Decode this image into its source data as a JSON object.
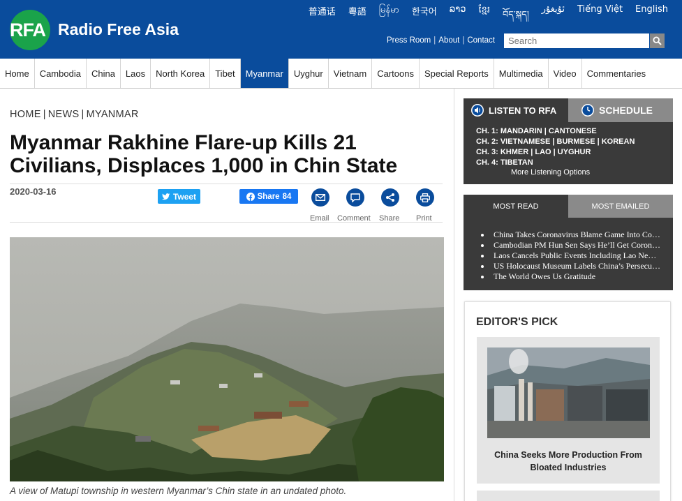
{
  "header": {
    "logo_text": "RFA",
    "site_name": "Radio Free Asia",
    "languages": [
      "普通话",
      "粵語",
      "မြန်မာ",
      "한국어",
      "ລາວ",
      "ខ្មែរ",
      "བོད་སྐད།",
      "ئۇيغۇر",
      "Tiếng Việt",
      "English"
    ],
    "links": [
      "Press Room",
      "About",
      "Contact"
    ],
    "search_placeholder": "Search"
  },
  "nav": {
    "items": [
      "Home",
      "Cambodia",
      "China",
      "Laos",
      "North Korea",
      "Tibet",
      "Myanmar",
      "Uyghur",
      "Vietnam",
      "Cartoons",
      "Special Reports",
      "Multimedia",
      "Video",
      "Commentaries"
    ],
    "active": "Myanmar"
  },
  "article": {
    "breadcrumb": [
      "HOME",
      "NEWS",
      "MYANMAR"
    ],
    "title_line1": "Myanmar Rakhine Flare-up Kills 21",
    "title_line2": "Civilians, Displaces 1,000 in Chin State",
    "date": "2020-03-16",
    "tweet_label": "Tweet",
    "share_label": "Share",
    "share_count": "84",
    "actions": [
      "Email",
      "Comment",
      "Share",
      "Print"
    ],
    "caption": "A view of Matupi township in western Myanmar’s Chin state in an undated photo."
  },
  "listen": {
    "tab_listen": "LISTEN TO RFA",
    "tab_schedule": "SCHEDULE",
    "channels": [
      "CH. 1: MANDARIN | CANTONESE",
      "CH. 2: VIETNAMESE | BURMESE | KOREAN",
      "CH. 3: KHMER | LAO | UYGHUR",
      "CH. 4: TIBETAN"
    ],
    "more": "More Listening Options"
  },
  "most": {
    "tab_read": "MOST READ",
    "tab_emailed": "MOST EMAILED",
    "items": [
      "China Takes Coronavirus Blame Game Into Co…",
      "Cambodian PM Hun Sen Says He’ll Get Coron…",
      "Laos Cancels Public Events Including Lao Ne…",
      "US Holocaust Museum Labels China’s Persecu…",
      "The World Owes Us Gratitude"
    ]
  },
  "editor": {
    "title": "EDITOR'S PICK",
    "caption_line1": "China Seeks More Production From",
    "caption_line2": "Bloated Industries"
  },
  "colors": {
    "brand_blue": "#0a4c9c",
    "logo_green": "#1aa34a",
    "panel_dark": "#3a3a3a",
    "panel_gray": "#8a8a8a"
  }
}
